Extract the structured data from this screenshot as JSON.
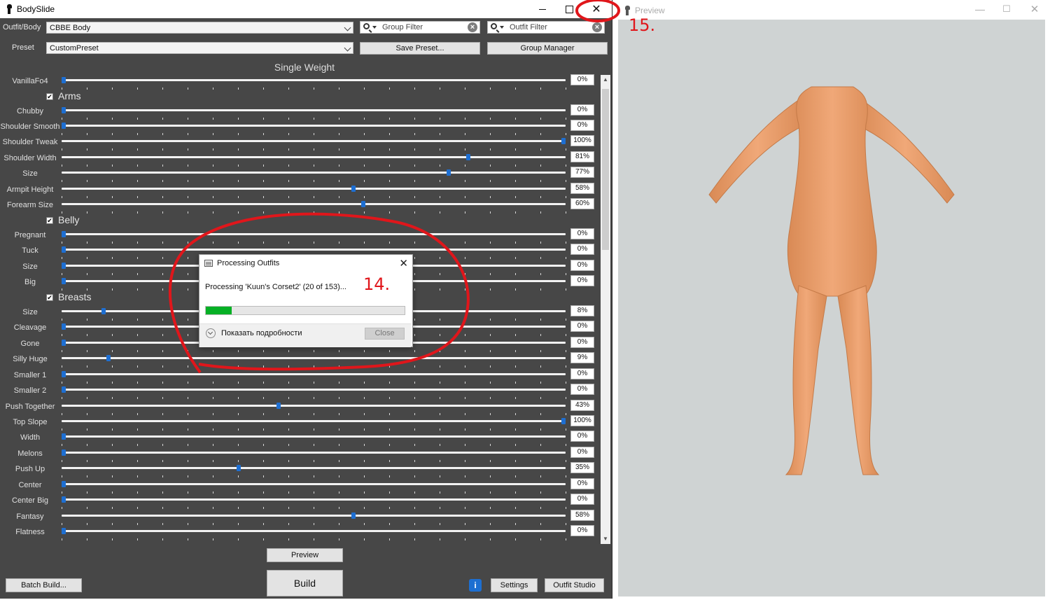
{
  "bodyslide": {
    "title": "BodySlide",
    "outfit_label": "Outfit/Body",
    "outfit_value": "CBBE Body",
    "group_filter_placeholder": "Group Filter",
    "outfit_filter_placeholder": "Outfit Filter",
    "preset_label": "Preset",
    "preset_value": "CustomPreset",
    "save_preset": "Save Preset...",
    "group_manager": "Group Manager",
    "section_title": "Single Weight",
    "categories": {
      "arms": "Arms",
      "belly": "Belly",
      "breasts": "Breasts"
    },
    "preview_button": "Preview",
    "build_button": "Build",
    "batch_build_button": "Batch Build...",
    "settings_button": "Settings",
    "outfit_studio_button": "Outfit Studio",
    "info_icon": "i",
    "checkmark": "✔"
  },
  "sliders": [
    {
      "label": "VanillaFo4",
      "value": 0,
      "display": "0%"
    },
    {
      "label": "Chubby",
      "value": 0,
      "display": "0%"
    },
    {
      "label": "Shoulder Smooth",
      "value": 0,
      "display": "0%"
    },
    {
      "label": "Shoulder Tweak",
      "value": 100,
      "display": "100%"
    },
    {
      "label": "Shoulder Width",
      "value": 81,
      "display": "81%"
    },
    {
      "label": "Size",
      "value": 77,
      "display": "77%"
    },
    {
      "label": "Armpit Height",
      "value": 58,
      "display": "58%"
    },
    {
      "label": "Forearm Size",
      "value": 60,
      "display": "60%"
    },
    {
      "label": "Pregnant",
      "value": 0,
      "display": "0%"
    },
    {
      "label": "Tuck",
      "value": 0,
      "display": "0%"
    },
    {
      "label": "Size",
      "value": 0,
      "display": "0%"
    },
    {
      "label": "Big",
      "value": 0,
      "display": "0%"
    },
    {
      "label": "Size",
      "value": 8,
      "display": "8%"
    },
    {
      "label": "Cleavage",
      "value": 0,
      "display": "0%"
    },
    {
      "label": "Gone",
      "value": 0,
      "display": "0%"
    },
    {
      "label": "Silly Huge",
      "value": 9,
      "display": "9%"
    },
    {
      "label": "Smaller 1",
      "value": 0,
      "display": "0%"
    },
    {
      "label": "Smaller 2",
      "value": 0,
      "display": "0%"
    },
    {
      "label": "Push Together",
      "value": 43,
      "display": "43%"
    },
    {
      "label": "Top Slope",
      "value": 100,
      "display": "100%"
    },
    {
      "label": "Width",
      "value": 0,
      "display": "0%"
    },
    {
      "label": "Melons",
      "value": 0,
      "display": "0%"
    },
    {
      "label": "Push Up",
      "value": 35,
      "display": "35%"
    },
    {
      "label": "Center",
      "value": 0,
      "display": "0%"
    },
    {
      "label": "Center Big",
      "value": 0,
      "display": "0%"
    },
    {
      "label": "Fantasy",
      "value": 58,
      "display": "58%"
    },
    {
      "label": "Flatness",
      "value": 0,
      "display": "0%"
    }
  ],
  "dialog": {
    "title": "Processing Outfits",
    "message": "Processing 'Kuun's Corset2' (20 of 153)...",
    "progress": 0.13,
    "details": "Показать подробности",
    "close": "Close"
  },
  "preview": {
    "title": "Preview"
  },
  "annotations": {
    "step14": "14.",
    "step15": "15."
  },
  "colors": {
    "accent": "#1e6fd2",
    "progress": "#06b025",
    "annotation": "#e0161b"
  }
}
